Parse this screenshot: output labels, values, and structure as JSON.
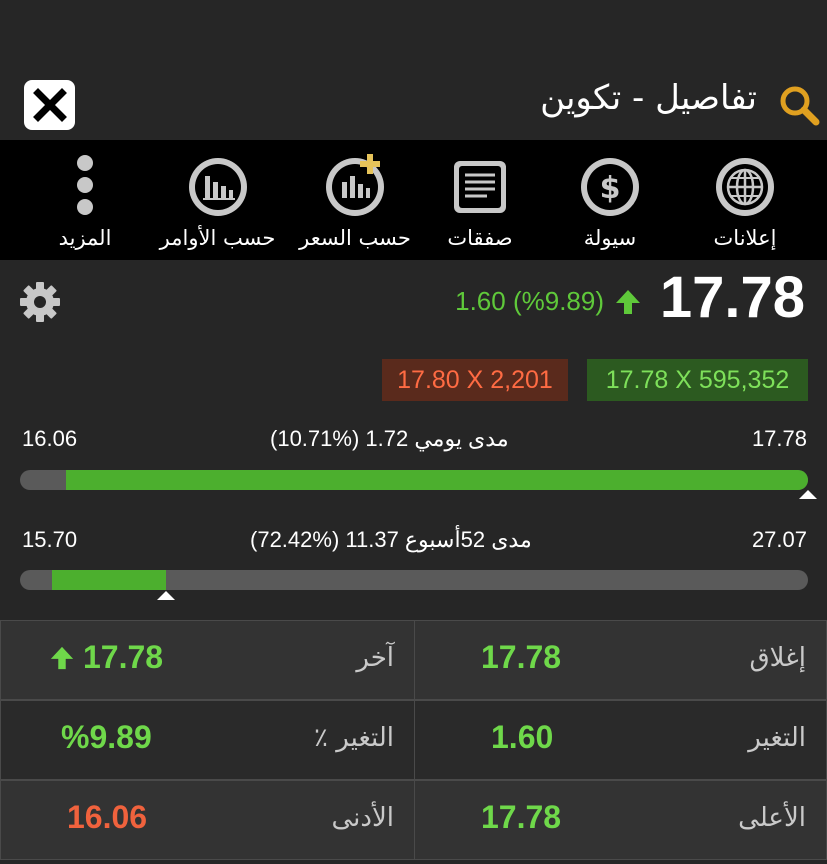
{
  "header": {
    "title": "تفاصيل - تكوين"
  },
  "toolbar": {
    "items": [
      {
        "label": "إعلانات",
        "icon": "globe-icon"
      },
      {
        "label": "سيولة",
        "icon": "dollar-icon"
      },
      {
        "label": "صفقات",
        "icon": "document-icon"
      },
      {
        "label": "حسب السعر",
        "icon": "chart-plus-icon"
      },
      {
        "label": "حسب الأوامر",
        "icon": "chart-icon"
      },
      {
        "label": "المزيد",
        "icon": "more-icon"
      }
    ]
  },
  "quote": {
    "last": "17.78",
    "change": "1.60 (%9.89)",
    "bid": "17.78 X 595,352",
    "ask": "17.80 X 2,201"
  },
  "daily_range": {
    "low": "16.06",
    "high": "17.78",
    "label": "مدى يومي 1.72 (%10.71)",
    "fill_fraction_start": 0.058,
    "marker_fraction": 1.0
  },
  "week52_range": {
    "low": "15.70",
    "high": "27.07",
    "label": "مدى 52أسبوع 11.37 (%72.42)",
    "fill_fraction_end": 0.185,
    "marker_fraction": 0.185
  },
  "stats": {
    "close_label": "إغلاق",
    "close_value": "17.78",
    "last_label": "آخر",
    "last_value": "17.78",
    "change_label": "التغير",
    "change_value": "1.60",
    "change_pct_label": "التغير ٪",
    "change_pct_value": "%9.89",
    "high_label": "الأعلى",
    "high_value": "17.78",
    "low_label": "الأدنى",
    "low_value": "16.06"
  },
  "colors": {
    "up": "#6fd84a",
    "down": "#f0623d",
    "bar_fill": "#4caf2e"
  }
}
